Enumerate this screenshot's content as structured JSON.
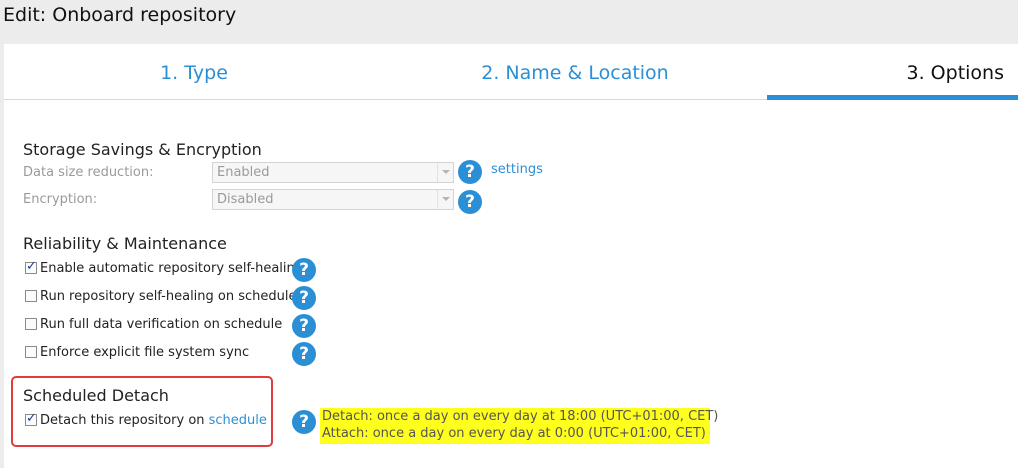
{
  "window": {
    "title": "Edit: Onboard repository"
  },
  "tabs": [
    {
      "label": "1. Type"
    },
    {
      "label": "2. Name & Location"
    },
    {
      "label": "3. Options"
    }
  ],
  "storage": {
    "title": "Storage Savings & Encryption",
    "data_size_reduction": {
      "label": "Data size reduction:",
      "value": "Enabled"
    },
    "encryption": {
      "label": "Encryption:",
      "value": "Disabled"
    },
    "settings_link": "settings"
  },
  "reliability": {
    "title": "Reliability & Maintenance",
    "items": [
      {
        "label": "Enable automatic repository self-healing",
        "checked": true
      },
      {
        "label": "Run repository self-healing on schedule",
        "checked": false
      },
      {
        "label": "Run full data verification on schedule",
        "checked": false
      },
      {
        "label": "Enforce explicit file system sync",
        "checked": false
      }
    ]
  },
  "scheduled_detach": {
    "title": "Scheduled Detach",
    "checkbox_text": "Detach this repository on ",
    "schedule_link": "schedule",
    "checked": true,
    "detach_info": "Detach: once a day on every day at 18:00 (UTC+01:00, CET)",
    "attach_info": "Attach: once a day on every day at 0:00 (UTC+01:00, CET)"
  },
  "help_symbol": "?",
  "colors": {
    "accent": "#2b8fd6",
    "highlight": "#ffff1e",
    "annotation": "#e23b3b"
  }
}
